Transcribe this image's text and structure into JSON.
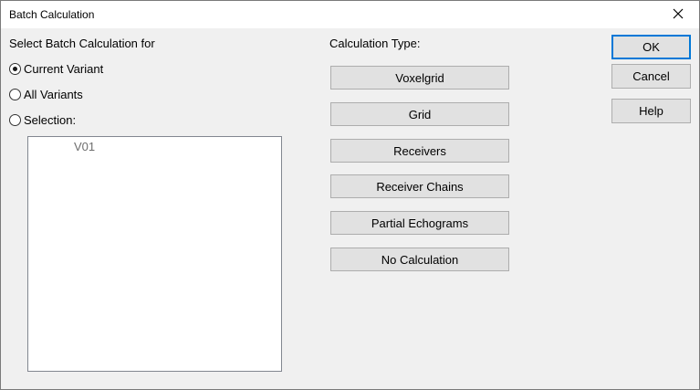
{
  "window": {
    "title": "Batch Calculation",
    "close_icon": "close-icon"
  },
  "left": {
    "heading": "Select Batch Calculation for",
    "options": [
      {
        "label": "Current Variant",
        "checked": true
      },
      {
        "label": "All Variants",
        "checked": false
      },
      {
        "label": "Selection:",
        "checked": false
      }
    ],
    "list_items": [
      "V01"
    ]
  },
  "calc": {
    "heading": "Calculation Type:",
    "buttons": [
      "Voxelgrid",
      "Grid",
      "Receivers",
      "Receiver Chains",
      "Partial Echograms",
      "No Calculation"
    ]
  },
  "actions": {
    "ok": "OK",
    "cancel": "Cancel",
    "help": "Help"
  },
  "colors": {
    "default_button_border": "#0078d7",
    "button_face": "#e1e1e1",
    "dialog_bg": "#f0f0f0",
    "list_item_text": "#6d6d6d"
  }
}
